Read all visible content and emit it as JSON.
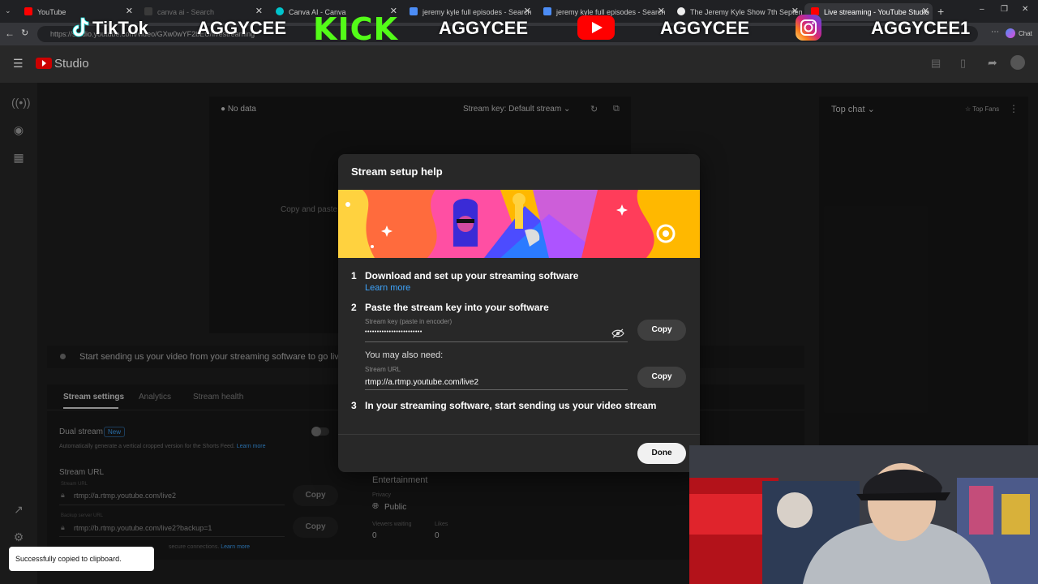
{
  "browser": {
    "tabs": [
      {
        "label": "YouTube",
        "color": "#ff0000"
      },
      {
        "label": "canva ai - Search",
        "color": "#3a3a3a"
      },
      {
        "label": "Canva AI - Canva",
        "color": "#00c4cc"
      },
      {
        "label": "jeremy kyle full episodes - Search",
        "color": "#4c8df6"
      },
      {
        "label": "jeremy kyle full episodes - Search",
        "color": "#4c8df6"
      },
      {
        "label": "The Jeremy Kyle Show 7th Septem",
        "color": "#eee"
      },
      {
        "label": "Live streaming - YouTube Studio",
        "color": "#ff0000"
      }
    ],
    "url": "https://studio.youtube.com/video/GXw0wYF2bEU/livestreaming",
    "chat_label": "Chat"
  },
  "overlay": {
    "brands": [
      {
        "name": "TikTok",
        "handle": "AGGYCEE"
      },
      {
        "name": "KICK",
        "handle": "AGGYCEE"
      },
      {
        "name": "YouTube",
        "handle": "AGGYCEE"
      },
      {
        "name": "Instagram",
        "handle": "AGGYCEE1"
      }
    ]
  },
  "studio": {
    "logo_text": "Studio",
    "preview": {
      "no_data": "No data",
      "stream_key_label": "Stream key: Default stream",
      "copy_paste_hint": "Copy and paste a"
    },
    "top_chat": {
      "label": "Top chat",
      "top_fans": "Top Fans"
    },
    "status_line": "Start sending us your video from your streaming software to go live",
    "tabs": [
      "Stream settings",
      "Analytics",
      "Stream health"
    ],
    "dual_stream": {
      "label": "Dual stream",
      "badge": "New",
      "description": "Automatically generate a vertical cropped version for the Shorts Feed.",
      "learn_more": "Learn more"
    },
    "stream_url_section": {
      "title": "Stream URL",
      "stream_url_label": "Stream URL",
      "stream_url_value": "rtmp://a.rtmp.youtube.com/live2",
      "backup_label": "Backup server URL",
      "backup_value": "rtmp://b.rtmp.youtube.com/live2?backup=1",
      "copy": "Copy",
      "secure_note": "secure connections.",
      "learn_more": "Learn more"
    },
    "details": {
      "category": "Entertainment",
      "privacy_label": "Privacy",
      "privacy_value": "Public",
      "viewers_label": "Viewers waiting",
      "viewers_value": "0",
      "likes_label": "Likes",
      "likes_value": "0"
    }
  },
  "modal": {
    "title": "Stream setup help",
    "step1": {
      "num": "1",
      "text": "Download and set up your streaming software",
      "link": "Learn more"
    },
    "step2": {
      "num": "2",
      "text": "Paste the stream key into your software",
      "key_label": "Stream key (paste in encoder)",
      "key_value": "••••••••••••••••••••••••",
      "copy": "Copy",
      "also_need": "You may also need:",
      "url_label": "Stream URL",
      "url_value": "rtmp://a.rtmp.youtube.com/live2",
      "copy2": "Copy"
    },
    "step3": {
      "num": "3",
      "text": "In your streaming software, start sending us your video stream"
    },
    "done": "Done"
  },
  "toast": {
    "text": "Successfully copied to clipboard."
  }
}
